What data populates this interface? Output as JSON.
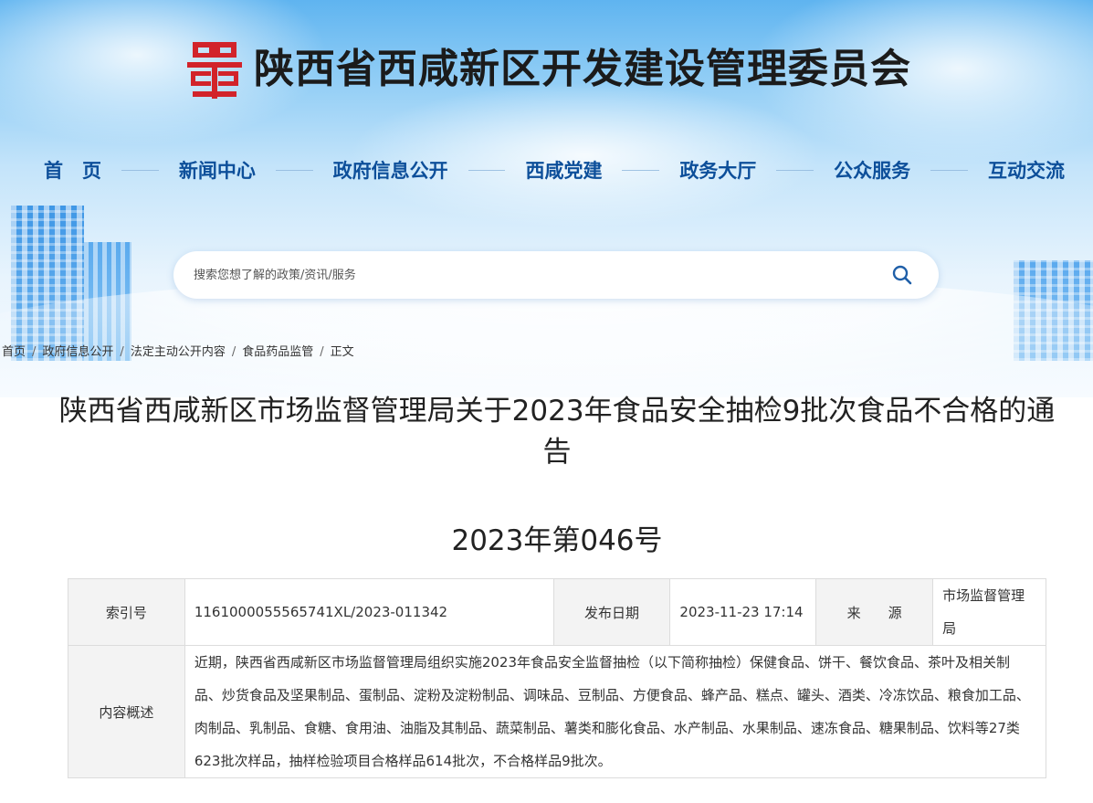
{
  "header": {
    "site_title": "陕西省西咸新区开发建设管理委员会",
    "logo_icon": "seal-logo-icon",
    "brand_color": "#d2232a"
  },
  "nav": {
    "items": [
      {
        "label": "首　页"
      },
      {
        "label": "新闻中心"
      },
      {
        "label": "政府信息公开"
      },
      {
        "label": "西咸党建"
      },
      {
        "label": "政务大厅"
      },
      {
        "label": "公众服务"
      },
      {
        "label": "互动交流"
      }
    ],
    "color": "#0d4f9a"
  },
  "search": {
    "placeholder": "搜索您想了解的政策/资讯/服务",
    "icon": "search-icon"
  },
  "breadcrumb": {
    "items": [
      "首页",
      "政府信息公开",
      "法定主动公开内容",
      "食品药品监管",
      "正文"
    ],
    "separator": "/"
  },
  "article": {
    "title": "陕西省西咸新区市场监督管理局关于2023年食品安全抽检9批次食品不合格的通告",
    "doc_number": "2023年第046号"
  },
  "meta": {
    "index_label": "索引号",
    "index_value": "1161000055565741XL/2023-011342",
    "date_label": "发布日期",
    "date_value": "2023-11-23 17:14",
    "source_label": "来　　源",
    "source_value": "市场监督管理局",
    "summary_label": "内容概述",
    "summary_value": "近期，陕西省西咸新区市场监督管理局组织实施2023年食品安全监督抽检（以下简称抽检）保健食品、饼干、餐饮食品、茶叶及相关制品、炒货食品及坚果制品、蛋制品、淀粉及淀粉制品、调味品、豆制品、方便食品、蜂产品、糕点、罐头、酒类、冷冻饮品、粮食加工品、肉制品、乳制品、食糖、食用油、油脂及其制品、蔬菜制品、薯类和膨化食品、水产制品、水果制品、速冻食品、糖果制品、饮料等27类623批次样品，抽样检验项目合格样品614批次，不合格样品9批次。"
  }
}
